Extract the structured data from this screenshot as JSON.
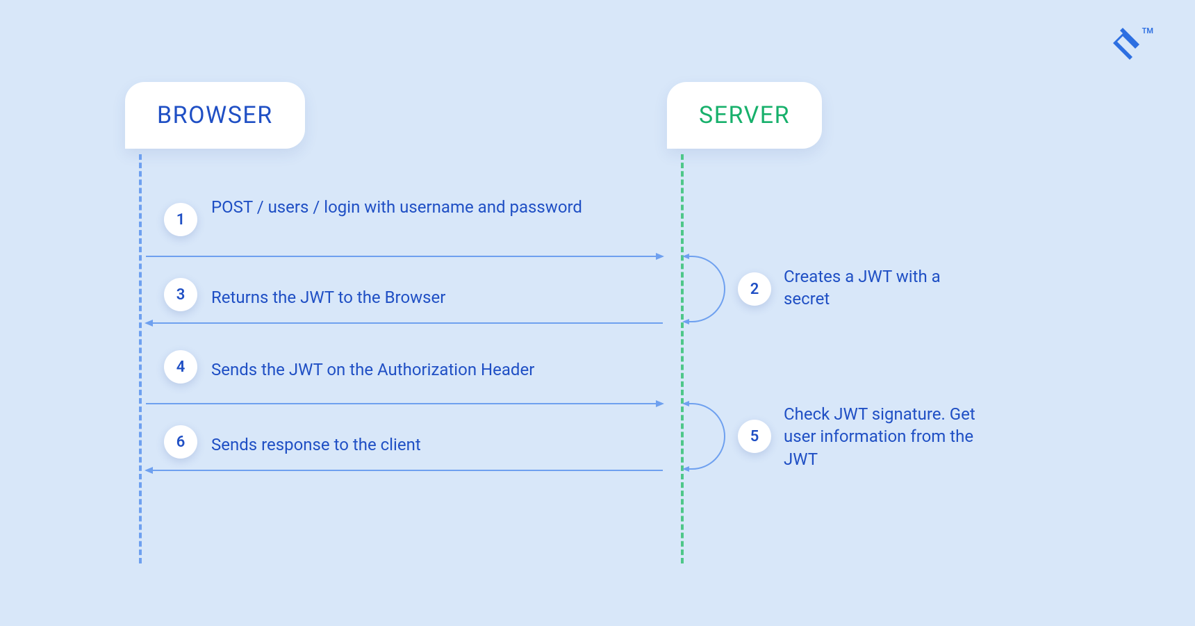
{
  "brand": {
    "name": "toptal-logo",
    "tm": "TM"
  },
  "headers": {
    "browser": "BROWSER",
    "server": "SERVER"
  },
  "steps": {
    "s1": {
      "num": "1",
      "text": "POST / users / login with username and password"
    },
    "s2": {
      "num": "2",
      "text": "Creates a JWT with a secret"
    },
    "s3": {
      "num": "3",
      "text": "Returns the JWT to the Browser"
    },
    "s4": {
      "num": "4",
      "text": "Sends the JWT on the Authorization Header"
    },
    "s5": {
      "num": "5",
      "text": "Check JWT signature. Get user information from the JWT"
    },
    "s6": {
      "num": "6",
      "text": "Sends response to the client"
    }
  },
  "colors": {
    "bg": "#d8e7f9",
    "blue": "#1f4fc4",
    "lineBlue": "#6ea0ef",
    "green": "#17b06b",
    "lineGreen": "#4ec789",
    "white": "#ffffff"
  }
}
